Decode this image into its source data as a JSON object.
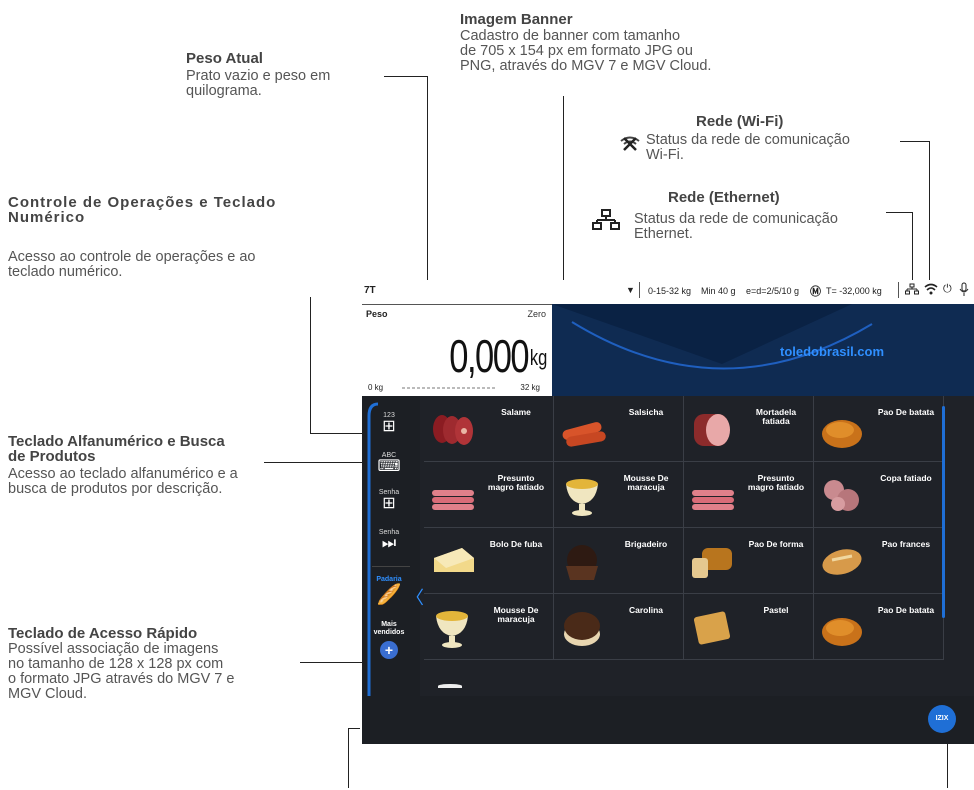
{
  "annotations": {
    "banner": {
      "title": "Imagem Banner",
      "lines": [
        "Cadastro de banner com tamanho",
        "de 705 x 154 px em formato JPG ou",
        "PNG, através do MGV 7 e MGV Cloud."
      ]
    },
    "peso": {
      "title": "Peso Atual",
      "lines": [
        "Prato vazio e peso em",
        "quilograma."
      ]
    },
    "wifi": {
      "title": "Rede (Wi-Fi)",
      "lines": [
        "Status da rede de comunicação",
        "Wi-Fi."
      ]
    },
    "ethernet": {
      "title": "Rede (Ethernet)",
      "lines": [
        "Status da rede de comunicação",
        "Ethernet."
      ]
    },
    "controle": {
      "title_lines": [
        "Controle de Operações e Teclado",
        "Numérico"
      ],
      "lines": [
        "Acesso ao controle de operações e ao",
        "teclado numérico."
      ]
    },
    "alfanumerico": {
      "title_lines": [
        "Teclado Alfanumérico e Busca",
        "de Produtos"
      ],
      "lines": [
        "Acesso ao teclado alfanumérico e a",
        "busca de produtos por descrição."
      ]
    },
    "rapido": {
      "title": "Teclado de Acesso Rápido",
      "lines": [
        "Possível associação de imagens",
        "no tamanho de 128 x 128 px   com",
        "o formato JPG através do MGV 7 e",
        "MGV Cloud."
      ]
    }
  },
  "status_bar": {
    "left": "7T",
    "arrow": "▼",
    "capacity": "0-15-32 kg",
    "min": "Min 40 g",
    "e": "e=d=2/5/10 g",
    "tare": "T= -32,000 kg",
    "icons": [
      "ethernet-icon",
      "wifi-icon",
      "power-icon",
      "microphone-icon"
    ]
  },
  "weight": {
    "label": "Peso",
    "zero": "Zero",
    "value": "0,000",
    "unit": "kg",
    "min": "0 kg",
    "max": "32 kg"
  },
  "banner": {
    "text": "toledobrasil.com"
  },
  "sidebar": {
    "items": [
      {
        "label": "123",
        "icon": "grid-icon"
      },
      {
        "label": "ABC",
        "icon": "keyboard-icon"
      },
      {
        "label": "Senha",
        "icon": "grid-icon"
      },
      {
        "label": "Senha",
        "icon": "play-next-icon"
      }
    ],
    "categories": [
      {
        "label": "Padaria",
        "active": true
      },
      {
        "label": "Mais vendidos",
        "active": false
      }
    ]
  },
  "products": [
    [
      "Salame",
      "Salsicha",
      "Mortadela fatiada",
      "Pao De batata"
    ],
    [
      "Presunto magro fatiado",
      "Mousse De maracuja",
      "Presunto magro fatiado",
      "Copa fatiado"
    ],
    [
      "Bolo De fuba",
      "Brigadeiro",
      "Pao De forma",
      "Pao frances"
    ],
    [
      "Mousse De maracuja",
      "Carolina",
      "Pastel",
      "Pao De batata"
    ]
  ],
  "footer": {
    "badge": "IZIX",
    "status_color": "#2ecc40"
  },
  "colors": {
    "banner": "#0f2b52",
    "app_bg": "#1f2228",
    "accent": "#1f6fd6",
    "link_text": "#2f8fff"
  }
}
